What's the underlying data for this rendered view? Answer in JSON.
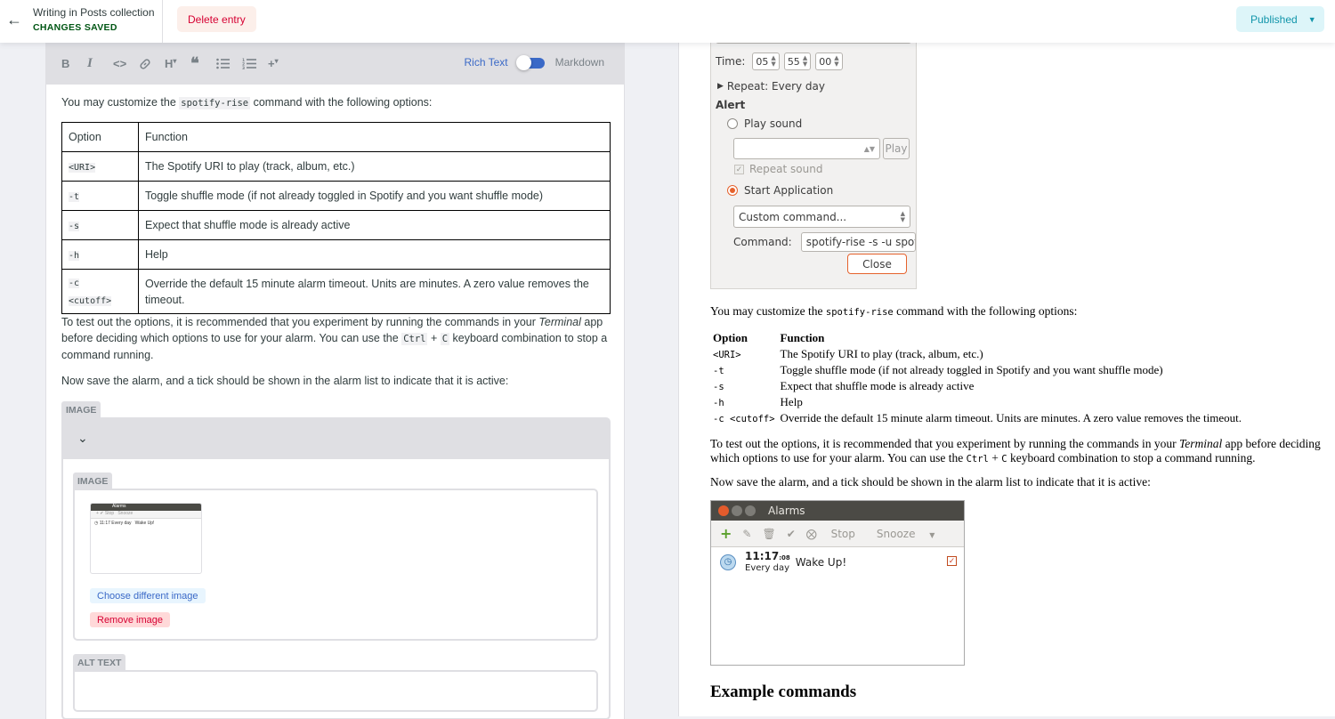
{
  "header": {
    "title": "Writing in Posts collection",
    "status": "CHANGES SAVED",
    "delete_label": "Delete entry",
    "publish_label": "Published"
  },
  "toolbar": {
    "icons": [
      "bold-icon",
      "italic-icon",
      "code-icon",
      "link-icon",
      "heading-icon",
      "quote-icon",
      "bulleted-list-icon",
      "numbered-list-icon",
      "add-component-icon"
    ],
    "bold": "B",
    "italic": "I",
    "code": "<>",
    "heading": "H",
    "rich_text_label": "Rich Text",
    "markdown_label": "Markdown",
    "rich_text_enabled": true
  },
  "editor": {
    "intro_before": "You may customize the ",
    "intro_code": "spotify-rise",
    "intro_after": " command with the following options:",
    "table_headers": [
      "Option",
      "Function"
    ],
    "table_rows": [
      {
        "option": "<URI>",
        "function": "The Spotify URI to play (track, album, etc.)"
      },
      {
        "option": "-t",
        "function": "Toggle shuffle mode (if not already toggled in Spotify and you want shuffle mode)"
      },
      {
        "option": "-s",
        "function": "Expect that shuffle mode is already active"
      },
      {
        "option": "-h",
        "function": "Help"
      },
      {
        "option": "-c <cutoff>",
        "option_a": "-c",
        "option_b": "<cutoff>",
        "function": "Override the default 15 minute alarm timeout. Units are minutes. A zero value removes the timeout."
      }
    ],
    "test_p1": "To test out the options, it is recommended that you experiment by running the commands in your ",
    "test_em": "Terminal",
    "test_p2": " app before deciding which options to use for your alarm. You can use the ",
    "test_code1": "Ctrl",
    "test_plus": " + ",
    "test_code2": "C",
    "test_p3": " keyboard combination to stop a command running.",
    "save_text": "Now save the alarm, and a tick should be shown in the alarm list to indicate that it is active:",
    "image_label": "IMAGE",
    "inner_image_label": "IMAGE",
    "choose_label": "Choose different image",
    "remove_label": "Remove image",
    "alt_label": "ALT TEXT",
    "alt_value": ""
  },
  "preview": {
    "dialog": {
      "time_label": "Time:",
      "hours": "05",
      "minutes": "55",
      "seconds": "00",
      "repeat_label": "Repeat: Every day",
      "alert_label": "Alert",
      "play_sound_label": "Play sound",
      "play_label": "Play",
      "repeat_sound_label": "Repeat sound",
      "start_app_label": "Start Application",
      "combo_value": "Custom command...",
      "command_label": "Command:",
      "command_value": "spotify-rise -s -u spotif",
      "close_label": "Close"
    },
    "intro_before": "You may customize the ",
    "intro_code": "spotify-rise",
    "intro_after": " command with the following options:",
    "table_headers": [
      "Option",
      "Function"
    ],
    "table_rows": [
      {
        "option": "<URI>",
        "function": "The Spotify URI to play (track, album, etc.)"
      },
      {
        "option": "-t",
        "function": "Toggle shuffle mode (if not already toggled in Spotify and you want shuffle mode)"
      },
      {
        "option": "-s",
        "function": "Expect that shuffle mode is already active"
      },
      {
        "option": "-h",
        "function": "Help"
      },
      {
        "option": "-c <cutoff>",
        "function": "Override the default 15 minute alarm timeout. Units are minutes. A zero value removes the timeout."
      }
    ],
    "test_p1": "To test out the options, it is recommended that you experiment by running the commands in your ",
    "test_em": "Terminal",
    "test_p2": " app before deciding which options to use for your alarm. You can use the ",
    "test_code1": "Ctrl",
    "test_plus": " + ",
    "test_code2": "C",
    "test_p3": " keyboard combination to stop a command running.",
    "save_text": "Now save the alarm, and a tick should be shown in the alarm list to indicate that it is active:",
    "alarms": {
      "title": "Alarms",
      "stop_label": "Stop",
      "snooze_label": "Snooze",
      "time": "11:17",
      "seconds": ":08",
      "repeat": "Every day",
      "name": "Wake Up!"
    },
    "heading": "Example commands"
  },
  "colors": {
    "accent": "#3a69c7",
    "status_green": "#005614",
    "danger": "#d60032",
    "publish": "#1195aa",
    "ubuntu_orange": "#e5622d"
  }
}
